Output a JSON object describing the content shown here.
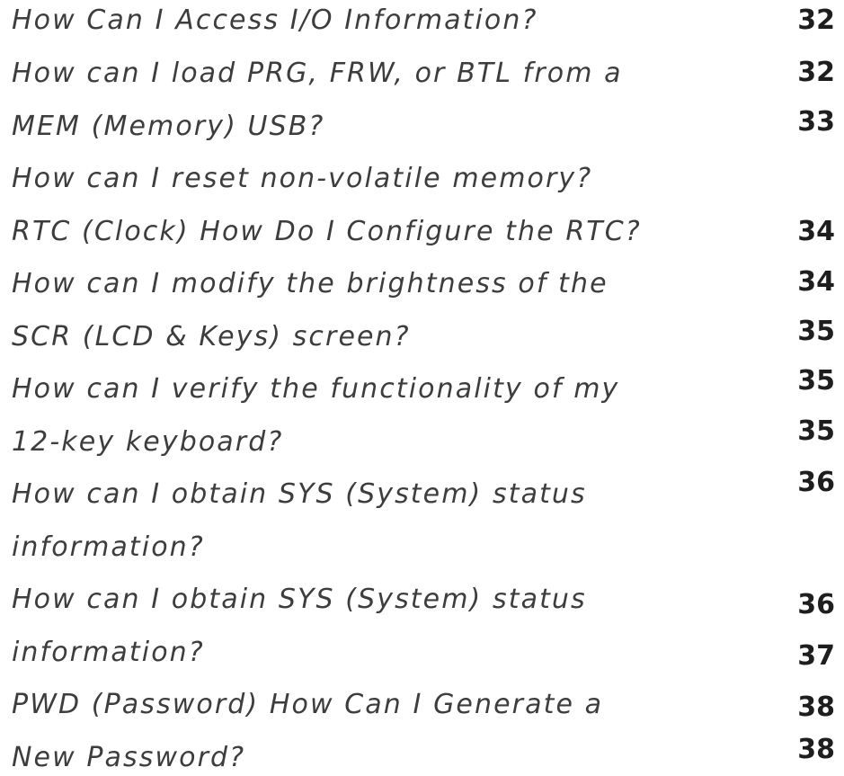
{
  "toc": {
    "lines": [
      "How Can I Access I/O Information?",
      "How can I load PRG, FRW, or BTL from a",
      "MEM (Memory) USB?",
      "How can I reset non-volatile memory?",
      "RTC (Clock) How Do I Configure the RTC?",
      "How can I modify the brightness of the",
      "SCR (LCD & Keys) screen?",
      "How can I verify the functionality of my",
      "12-key keyboard?",
      "How can I obtain SYS (System) status",
      "information?",
      "How can I obtain SYS (System) status",
      "information?",
      "PWD (Password) How Can I Generate a",
      "New Password?"
    ],
    "page_numbers": [
      "32",
      "32",
      "33",
      "34",
      "34",
      "35",
      "35",
      "35",
      "36",
      "36",
      "37",
      "38",
      "38"
    ]
  }
}
